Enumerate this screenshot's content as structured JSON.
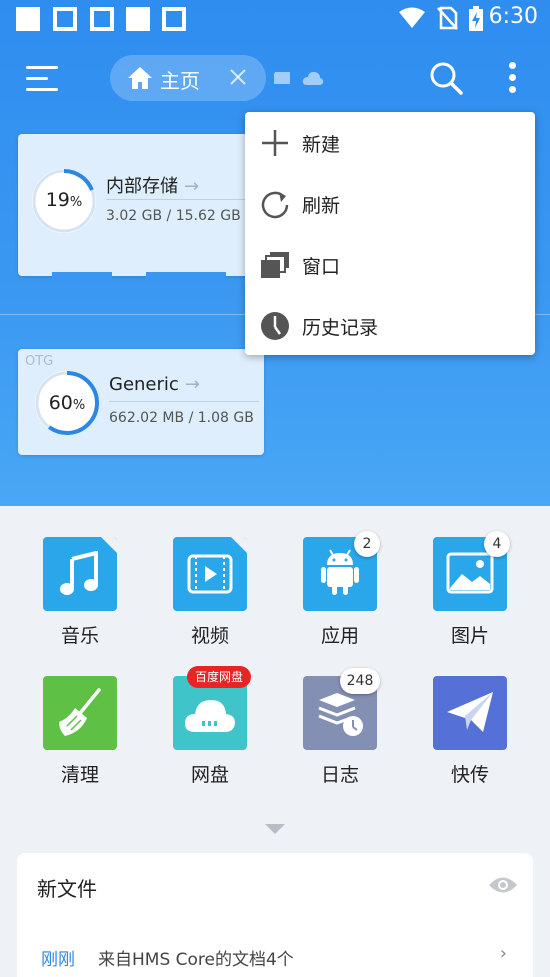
{
  "status": {
    "time": "6:30"
  },
  "appbar": {
    "tab_home_label": "主页"
  },
  "storage": {
    "internal": {
      "name": "内部存储",
      "percent": "19",
      "percent_unit": "%",
      "size": "3.02 GB / 15.62 GB",
      "used_fraction": 0.19
    },
    "otg": {
      "tag": "OTG",
      "name": "Generic",
      "percent": "60",
      "percent_unit": "%",
      "size": "662.02 MB / 1.08 GB",
      "used_fraction": 0.6
    }
  },
  "menu": {
    "items": [
      {
        "label": "新建",
        "icon": "plus-icon"
      },
      {
        "label": "刷新",
        "icon": "refresh-icon"
      },
      {
        "label": "窗口",
        "icon": "windows-icon"
      },
      {
        "label": "历史记录",
        "icon": "history-icon"
      }
    ]
  },
  "categories": [
    {
      "label": "音乐",
      "icon": "music-icon",
      "color": "#2aa6ea"
    },
    {
      "label": "视频",
      "icon": "video-icon",
      "color": "#2aa6ea"
    },
    {
      "label": "应用",
      "icon": "android-icon",
      "color": "#2aa6ea",
      "badge": "2"
    },
    {
      "label": "图片",
      "icon": "image-icon",
      "color": "#2aa6ea",
      "badge": "4"
    },
    {
      "label": "清理",
      "icon": "broom-icon",
      "color": "#5fc046"
    },
    {
      "label": "网盘",
      "icon": "cloud-disk-icon",
      "color": "#3fc4c9",
      "tag": "百度网盘"
    },
    {
      "label": "日志",
      "icon": "log-icon",
      "color": "#8390b4",
      "badge": "248"
    },
    {
      "label": "快传",
      "icon": "send-icon",
      "color": "#5570d6"
    }
  ],
  "new_files": {
    "title": "新文件",
    "time": "刚刚",
    "description": "来自HMS Core的文档4个"
  }
}
